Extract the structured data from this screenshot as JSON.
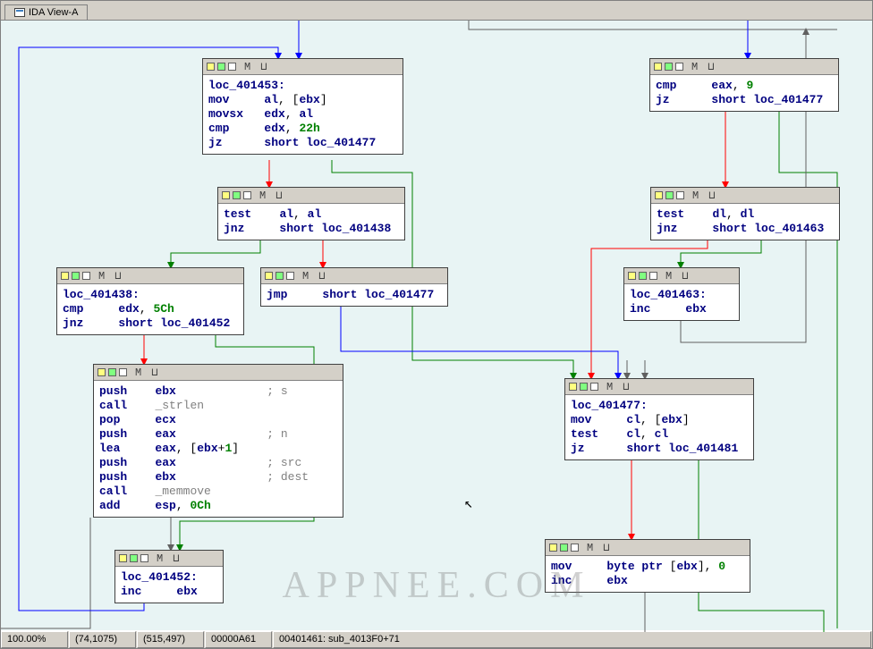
{
  "tab": {
    "label": "IDA View-A"
  },
  "header_icons": "M ⊔",
  "nodes": {
    "n1": {
      "lines": [
        [
          [
            "lbl",
            "loc_401453:"
          ]
        ],
        [
          [
            "kw",
            "mov"
          ],
          [
            "",
            "     "
          ],
          [
            "reg",
            "al"
          ],
          [
            "",
            ", ["
          ],
          [
            "reg",
            "ebx"
          ],
          [
            "",
            "]"
          ]
        ],
        [
          [
            "kw",
            "movsx"
          ],
          [
            "",
            "   "
          ],
          [
            "reg",
            "edx"
          ],
          [
            "",
            ", "
          ],
          [
            "reg",
            "al"
          ]
        ],
        [
          [
            "kw",
            "cmp"
          ],
          [
            "",
            "     "
          ],
          [
            "reg",
            "edx"
          ],
          [
            "",
            ", "
          ],
          [
            "num",
            "22h"
          ]
        ],
        [
          [
            "kw",
            "jz"
          ],
          [
            "",
            "      "
          ],
          [
            "kw",
            "short"
          ],
          [
            "",
            " "
          ],
          [
            "lbl",
            "loc_401477"
          ]
        ]
      ]
    },
    "n2": {
      "lines": [
        [
          [
            "kw",
            "cmp"
          ],
          [
            "",
            "     "
          ],
          [
            "reg",
            "eax"
          ],
          [
            "",
            ", "
          ],
          [
            "num",
            "9"
          ]
        ],
        [
          [
            "kw",
            "jz"
          ],
          [
            "",
            "      "
          ],
          [
            "kw",
            "short"
          ],
          [
            "",
            " "
          ],
          [
            "lbl",
            "loc_401477"
          ]
        ]
      ]
    },
    "n3": {
      "lines": [
        [
          [
            "kw",
            "test"
          ],
          [
            "",
            "    "
          ],
          [
            "reg",
            "al"
          ],
          [
            "",
            ", "
          ],
          [
            "reg",
            "al"
          ]
        ],
        [
          [
            "kw",
            "jnz"
          ],
          [
            "",
            "     "
          ],
          [
            "kw",
            "short"
          ],
          [
            "",
            " "
          ],
          [
            "lbl",
            "loc_401438"
          ]
        ]
      ]
    },
    "n4": {
      "lines": [
        [
          [
            "kw",
            "test"
          ],
          [
            "",
            "    "
          ],
          [
            "reg",
            "dl"
          ],
          [
            "",
            ", "
          ],
          [
            "reg",
            "dl"
          ]
        ],
        [
          [
            "kw",
            "jnz"
          ],
          [
            "",
            "     "
          ],
          [
            "kw",
            "short"
          ],
          [
            "",
            " "
          ],
          [
            "lbl",
            "loc_401463"
          ]
        ]
      ]
    },
    "n5": {
      "lines": [
        [
          [
            "lbl",
            "loc_401438:"
          ]
        ],
        [
          [
            "kw",
            "cmp"
          ],
          [
            "",
            "     "
          ],
          [
            "reg",
            "edx"
          ],
          [
            "",
            ", "
          ],
          [
            "num",
            "5Ch"
          ]
        ],
        [
          [
            "kw",
            "jnz"
          ],
          [
            "",
            "     "
          ],
          [
            "kw",
            "short"
          ],
          [
            "",
            " "
          ],
          [
            "lbl",
            "loc_401452"
          ]
        ]
      ]
    },
    "n6": {
      "lines": [
        [
          [
            "kw",
            "jmp"
          ],
          [
            "",
            "     "
          ],
          [
            "kw",
            "short"
          ],
          [
            "",
            " "
          ],
          [
            "lbl",
            "loc_401477"
          ]
        ]
      ]
    },
    "n7": {
      "lines": [
        [
          [
            "lbl",
            "loc_401463:"
          ]
        ],
        [
          [
            "kw",
            "inc"
          ],
          [
            "",
            "     "
          ],
          [
            "reg",
            "ebx"
          ]
        ]
      ]
    },
    "n8": {
      "lines": [
        [
          [
            "kw",
            "push"
          ],
          [
            "",
            "    "
          ],
          [
            "reg",
            "ebx"
          ],
          [
            "",
            "             "
          ],
          [
            "cmt",
            "; s"
          ]
        ],
        [
          [
            "kw",
            "call"
          ],
          [
            "",
            "    "
          ],
          [
            "fn",
            "_strlen"
          ]
        ],
        [
          [
            "kw",
            "pop"
          ],
          [
            "",
            "     "
          ],
          [
            "reg",
            "ecx"
          ]
        ],
        [
          [
            "kw",
            "push"
          ],
          [
            "",
            "    "
          ],
          [
            "reg",
            "eax"
          ],
          [
            "",
            "             "
          ],
          [
            "cmt",
            "; n"
          ]
        ],
        [
          [
            "kw",
            "lea"
          ],
          [
            "",
            "     "
          ],
          [
            "reg",
            "eax"
          ],
          [
            "",
            ", ["
          ],
          [
            "reg",
            "ebx"
          ],
          [
            "",
            "+"
          ],
          [
            "num",
            "1"
          ],
          [
            "",
            "]"
          ]
        ],
        [
          [
            "kw",
            "push"
          ],
          [
            "",
            "    "
          ],
          [
            "reg",
            "eax"
          ],
          [
            "",
            "             "
          ],
          [
            "cmt",
            "; src"
          ]
        ],
        [
          [
            "kw",
            "push"
          ],
          [
            "",
            "    "
          ],
          [
            "reg",
            "ebx"
          ],
          [
            "",
            "             "
          ],
          [
            "cmt",
            "; dest"
          ]
        ],
        [
          [
            "kw",
            "call"
          ],
          [
            "",
            "    "
          ],
          [
            "fn",
            "_memmove"
          ]
        ],
        [
          [
            "kw",
            "add"
          ],
          [
            "",
            "     "
          ],
          [
            "reg",
            "esp"
          ],
          [
            "",
            ", "
          ],
          [
            "num",
            "0Ch"
          ]
        ]
      ]
    },
    "n9": {
      "lines": [
        [
          [
            "lbl",
            "loc_401477:"
          ]
        ],
        [
          [
            "kw",
            "mov"
          ],
          [
            "",
            "     "
          ],
          [
            "reg",
            "cl"
          ],
          [
            "",
            ", ["
          ],
          [
            "reg",
            "ebx"
          ],
          [
            "",
            "]"
          ]
        ],
        [
          [
            "kw",
            "test"
          ],
          [
            "",
            "    "
          ],
          [
            "reg",
            "cl"
          ],
          [
            "",
            ", "
          ],
          [
            "reg",
            "cl"
          ]
        ],
        [
          [
            "kw",
            "jz"
          ],
          [
            "",
            "      "
          ],
          [
            "kw",
            "short"
          ],
          [
            "",
            " "
          ],
          [
            "lbl",
            "loc_401481"
          ]
        ]
      ]
    },
    "n10": {
      "lines": [
        [
          [
            "lbl",
            "loc_401452:"
          ]
        ],
        [
          [
            "kw",
            "inc"
          ],
          [
            "",
            "     "
          ],
          [
            "reg",
            "ebx"
          ]
        ]
      ]
    },
    "n11": {
      "lines": [
        [
          [
            "kw",
            "mov"
          ],
          [
            "",
            "     "
          ],
          [
            "kw",
            "byte ptr"
          ],
          [
            "",
            " ["
          ],
          [
            "reg",
            "ebx"
          ],
          [
            "",
            "], "
          ],
          [
            "num",
            "0"
          ]
        ],
        [
          [
            "kw",
            "inc"
          ],
          [
            "",
            "     "
          ],
          [
            "reg",
            "ebx"
          ]
        ]
      ]
    }
  },
  "status": {
    "zoom": "100.00%",
    "coord1": "(74,1075)",
    "coord2": "(515,497)",
    "offset": "00000A61",
    "addr": "00401461: sub_4013F0+71"
  },
  "watermark": "APPNEE.COM"
}
